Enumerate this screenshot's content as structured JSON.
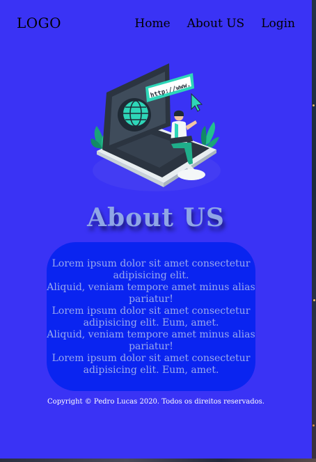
{
  "header": {
    "logo": "LOGO",
    "nav": [
      {
        "label": "Home"
      },
      {
        "label": "About US"
      },
      {
        "label": "Login"
      }
    ]
  },
  "hero": {
    "illustration": "laptop-website-illustration",
    "url_text": "http://www."
  },
  "main": {
    "title": "About US",
    "paragraphs": [
      "Lorem ipsum dolor sit amet consectetur adipisicing elit.",
      "Aliquid, veniam tempore amet minus alias pariatur!",
      "Lorem ipsum dolor sit amet consectetur adipisicing elit. Eum, amet.",
      "Aliquid, veniam tempore amet minus alias pariatur!",
      "Lorem ipsum dolor sit amet consectetur adipisicing elit. Eum, amet."
    ]
  },
  "footer": {
    "copyright": "Copyright © Pedro Lucas 2020. Todos os direitos reservados."
  },
  "colors": {
    "page_background": "#3a33f5",
    "bubble_background": "#0a24f0",
    "title_color": "#8fa6e6",
    "text_color": "#9aa9ee"
  }
}
